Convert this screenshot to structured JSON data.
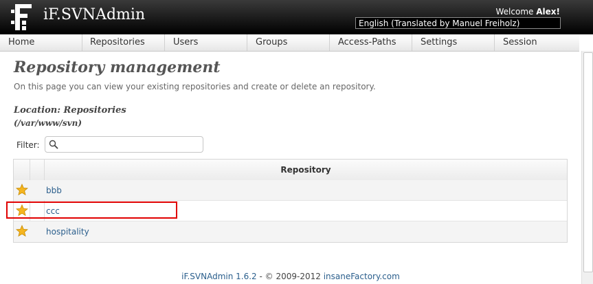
{
  "header": {
    "app_title": "iF.SVNAdmin",
    "welcome_prefix": "Welcome",
    "username": "Alex!",
    "language_selected": "English (Translated by Manuel Freiholz)"
  },
  "nav": {
    "items": [
      {
        "label": "Home"
      },
      {
        "label": "Repositories"
      },
      {
        "label": "Users"
      },
      {
        "label": "Groups"
      },
      {
        "label": "Access-Paths"
      },
      {
        "label": "Settings"
      },
      {
        "label": "Session"
      }
    ]
  },
  "main": {
    "title": "Repository management",
    "description": "On this page you can view your existing repositories and create or delete an repository.",
    "location_label": "Location: Repositories",
    "location_path": "(/var/www/svn)",
    "filter": {
      "label": "Filter:",
      "value": "",
      "placeholder": ""
    },
    "table": {
      "column_header": "Repository",
      "rows": [
        {
          "name": "bbb",
          "icon": "star-icon"
        },
        {
          "name": "ccc",
          "icon": "star-icon"
        },
        {
          "name": "hospitality",
          "icon": "star-icon"
        }
      ]
    }
  },
  "footer": {
    "version_link": "iF.SVNAdmin 1.6.2",
    "separator": " - © 2009-2012 ",
    "company_link": "insaneFactory.com"
  },
  "colors": {
    "link": "#2a5e8c",
    "highlight": "#e00000",
    "header_bg": "#000000"
  }
}
